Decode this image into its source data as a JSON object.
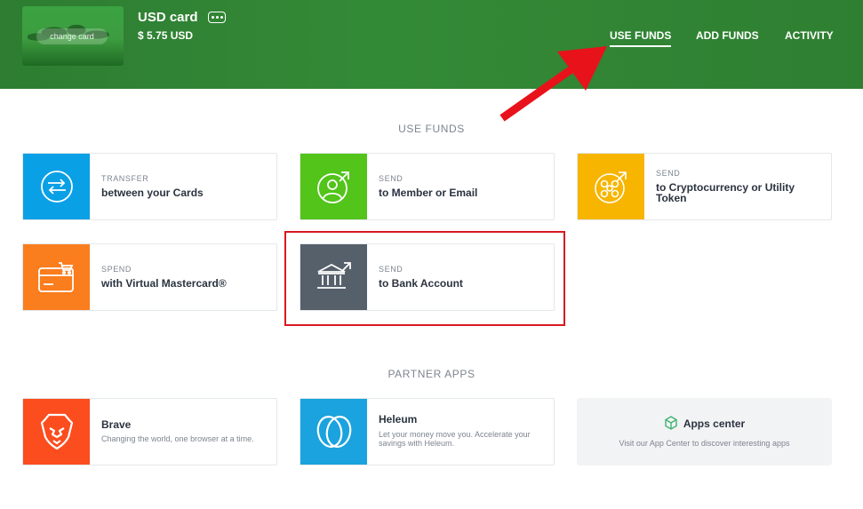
{
  "header": {
    "card_name": "USD card",
    "card_balance": "$ 5.75 USD",
    "change_card_label": "change card",
    "nav": [
      {
        "label": "USE FUNDS",
        "active": true
      },
      {
        "label": "ADD FUNDS",
        "active": false
      },
      {
        "label": "ACTIVITY",
        "active": false
      }
    ]
  },
  "use_funds": {
    "title": "USE FUNDS",
    "tiles": [
      {
        "kicker": "TRANSFER",
        "label": "between your Cards",
        "color": "#0aa0e6",
        "icon": "transfer-arrows-icon"
      },
      {
        "kicker": "SEND",
        "label": "to Member or Email",
        "color": "#52c41a",
        "icon": "member-send-icon"
      },
      {
        "kicker": "SEND",
        "label": "to Cryptocurrency or Utility Token",
        "color": "#f7b500",
        "icon": "crypto-send-icon"
      },
      {
        "kicker": "SPEND",
        "label": "with Virtual Mastercard®",
        "color": "#fa7d1e",
        "icon": "card-cart-icon"
      },
      {
        "kicker": "SEND",
        "label": "to Bank Account",
        "color": "#56606b",
        "icon": "bank-send-icon"
      }
    ]
  },
  "partner_apps": {
    "title": "PARTNER APPS",
    "apps": [
      {
        "name": "Brave",
        "desc": "Changing the world, one browser at a time.",
        "color": "#fb4d1e",
        "icon": "brave-lion-icon"
      },
      {
        "name": "Heleum",
        "desc": "Let your money move you. Accelerate your savings with Heleum.",
        "color": "#1aa3de",
        "icon": "heleum-logo-icon"
      }
    ],
    "apps_center": {
      "title": "Apps center",
      "desc": "Visit our App Center to discover interesting apps",
      "icon": "cube-icon"
    }
  },
  "colors": {
    "header_green": "#338a36",
    "annotation_red": "#d71920"
  }
}
